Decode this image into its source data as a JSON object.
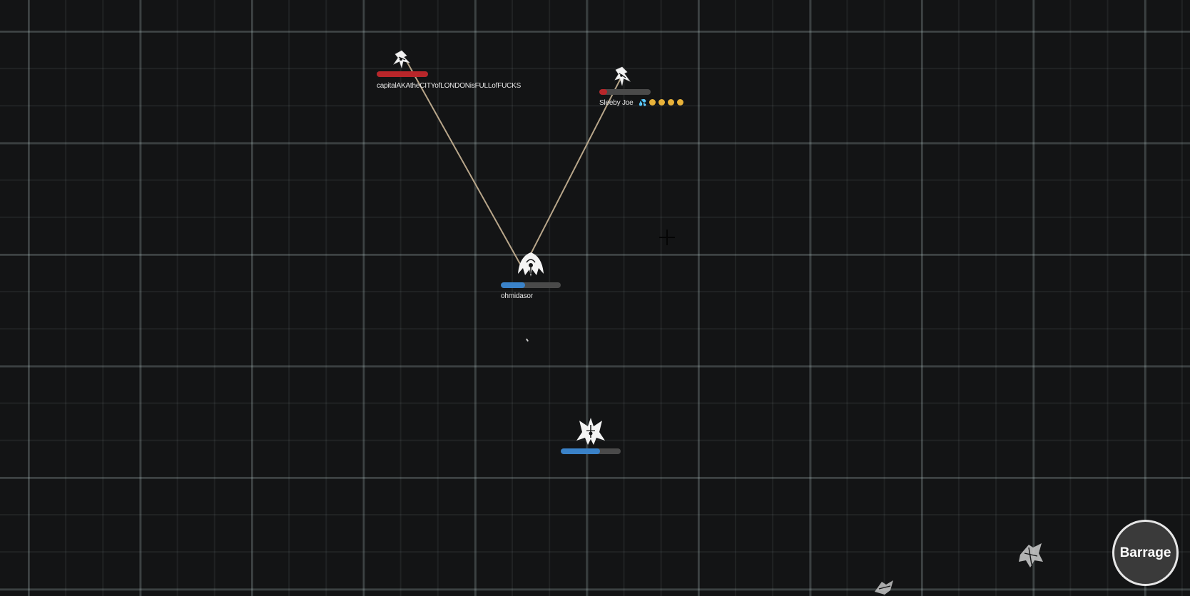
{
  "game": {
    "grid_color": "#b4c8c8",
    "background_color": "#131415",
    "tether_color": "#b8a68a"
  },
  "players": [
    {
      "name": "capitalAKAtheCITYofLONDONisFULLofFUCKS",
      "hp_fraction": 1.0,
      "hp_color": "#b8262a",
      "ship_icon": "fighter-ship-icon"
    },
    {
      "name": "Sleeby Joe",
      "name_emojis": [
        "💦",
        "😴",
        "😴",
        "😴",
        "😴"
      ],
      "hp_fraction": 0.15,
      "hp_color": "#b8262a",
      "ship_icon": "fighter-ship-icon"
    },
    {
      "name": "ohmidasor",
      "hp_fraction": 0.4,
      "hp_color": "#3a82c8",
      "ship_icon": "dome-ship-icon"
    },
    {
      "name": "",
      "hp_fraction": 0.65,
      "hp_color": "#3a82c8",
      "ship_icon": "winged-ship-icon"
    }
  ],
  "controls": {
    "barrage_label": "Barrage"
  },
  "icons": {
    "crosshair": "crosshair-icon",
    "distant_ships": [
      "distant-ship-icon",
      "distant-ship-icon"
    ]
  }
}
